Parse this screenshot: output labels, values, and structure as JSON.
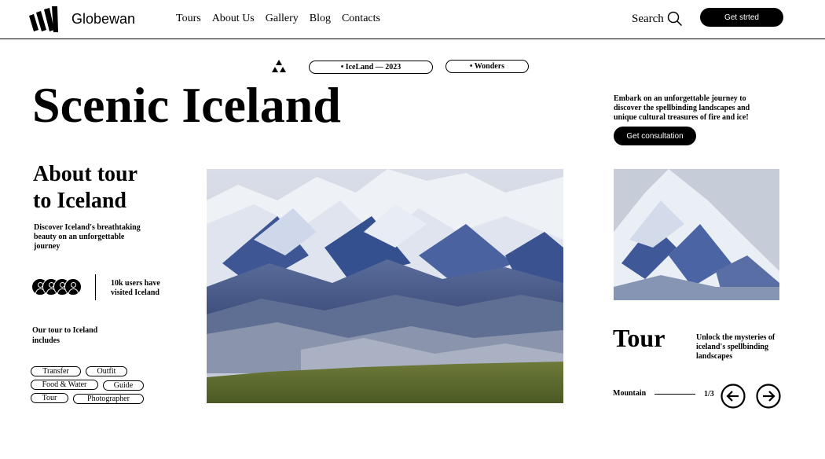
{
  "header": {
    "brand": "Globewan",
    "nav": [
      "Tours",
      "About Us",
      "Gallery",
      "Blog",
      "Contacts"
    ],
    "search_label": "Search",
    "cta_label": "Get strted"
  },
  "hero": {
    "tags": [
      "• IceLand — 2023",
      "• Wonders"
    ],
    "title": "Scenic Iceland",
    "intro": "Embark on an unforgettable journey to discover the spellbinding landscapes and unique cultural treasures of fire and ice!",
    "consult_label": "Get consultation"
  },
  "about": {
    "title_line1": "About tour",
    "title_line2": "to Iceland",
    "desc": "Discover Iceland's breathtaking beauty on an unforgettable journey",
    "users_text": "10k users have visited Iceland",
    "includes_label": "Our tour to Iceland includes",
    "chips": [
      "Transfer",
      "Outfit",
      "Food & Water",
      "Guide",
      "Tour",
      "Photographer"
    ]
  },
  "tour": {
    "title": "Tour",
    "desc": "Unlock the mysteries of iceland's spellbinding landscapes",
    "slide_label": "Mountain",
    "slide_count": "1/3"
  },
  "icons": [
    "logo-icon",
    "search-icon",
    "triangles-icon",
    "user-icon",
    "arrow-left-icon",
    "arrow-right-icon"
  ],
  "colors": {
    "primary": "#000000",
    "background": "#ffffff"
  }
}
